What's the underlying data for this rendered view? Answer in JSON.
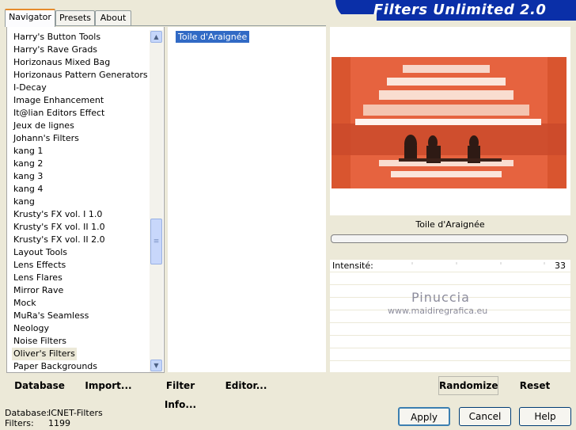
{
  "tabs": [
    {
      "label": "Navigator",
      "active": true
    },
    {
      "label": "Presets",
      "active": false
    },
    {
      "label": "About",
      "active": false
    }
  ],
  "app_title": "Filters Unlimited 2.0",
  "categories": [
    "Harry's Button Tools",
    "Harry's Rave Grads",
    "Horizonaus Mixed Bag",
    "Horizonaus Pattern Generators",
    "I-Decay",
    "Image Enhancement",
    "It@lian Editors Effect",
    "Jeux de lignes",
    "Johann's Filters",
    "kang 1",
    "kang 2",
    "kang 3",
    "kang 4",
    "kang",
    "Krusty's FX vol. I 1.0",
    "Krusty's FX vol. II 1.0",
    "Krusty's FX vol. II 2.0",
    "Layout Tools",
    "Lens Effects",
    "Lens Flares",
    "Mirror Rave",
    "Mock",
    "MuRa's Seamless",
    "Neology",
    "Noise Filters",
    "Oliver's Filters",
    "Paper Backgrounds"
  ],
  "selected_category_index": 25,
  "filters": [
    "Toile d'Araignée"
  ],
  "selected_filter": "Toile d'Araignée",
  "parameter": {
    "label": "Intensité:",
    "value": "33"
  },
  "watermark": {
    "line1": "Pinuccia",
    "line2": "www.maidiregrafica.eu"
  },
  "toolbar": {
    "database": "Database",
    "import": "Import...",
    "filter_info": "Filter Info...",
    "editor": "Editor...",
    "randomize": "Randomize",
    "reset": "Reset"
  },
  "status": {
    "database_label": "Database:",
    "database_value": "ICNET-Filters",
    "filters_label": "Filters:",
    "filters_value": "1199"
  },
  "buttons": {
    "apply": "Apply",
    "cancel": "Cancel",
    "help": "Help"
  },
  "colors": {
    "accent_tab": "#e68b2c",
    "banner": "#0a2fa8",
    "selection": "#316ac5",
    "preview_orange": "#e8623f"
  }
}
